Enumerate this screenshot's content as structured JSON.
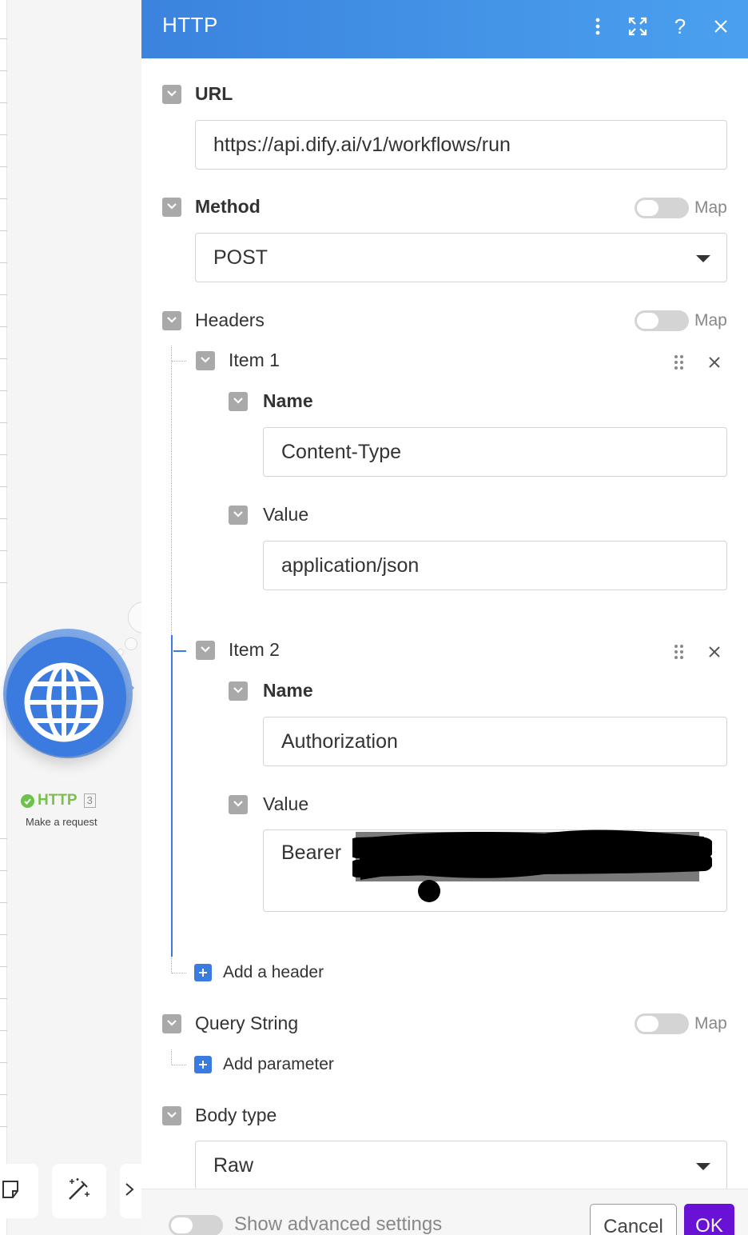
{
  "canvas": {
    "module": {
      "title": "HTTP",
      "count": "3",
      "subtitle": "Make a request"
    },
    "tools": [
      {
        "icon": "note-icon"
      },
      {
        "icon": "magic-wand-icon"
      },
      {
        "icon": "flow-icon"
      }
    ]
  },
  "panel": {
    "title": "HTTP",
    "header_icons": [
      "more-vertical-icon",
      "maximize-icon",
      "help-icon",
      "close-icon"
    ],
    "url": {
      "label": "URL",
      "value": "https://api.dify.ai/v1/workflows/run"
    },
    "method": {
      "label": "Method",
      "value": "POST",
      "map_label": "Map"
    },
    "headers": {
      "label": "Headers",
      "map_label": "Map",
      "items": [
        {
          "label": "Item 1",
          "name_label": "Name",
          "name_value": "Content-Type",
          "value_label": "Value",
          "value_value": "application/json"
        },
        {
          "label": "Item 2",
          "name_label": "Name",
          "name_value": "Authorization",
          "value_label": "Value",
          "value_value": "Bearer"
        }
      ],
      "add_label": "Add a header"
    },
    "query_string": {
      "label": "Query String",
      "map_label": "Map",
      "add_label": "Add parameter"
    },
    "body_type": {
      "label": "Body type",
      "value": "Raw"
    },
    "footer": {
      "advanced_label": "Show advanced settings",
      "cancel_label": "Cancel",
      "ok_label": "OK"
    }
  },
  "colors": {
    "accent": "#3b7be0",
    "ok": "#6a11d6",
    "success": "#6cc24a"
  }
}
